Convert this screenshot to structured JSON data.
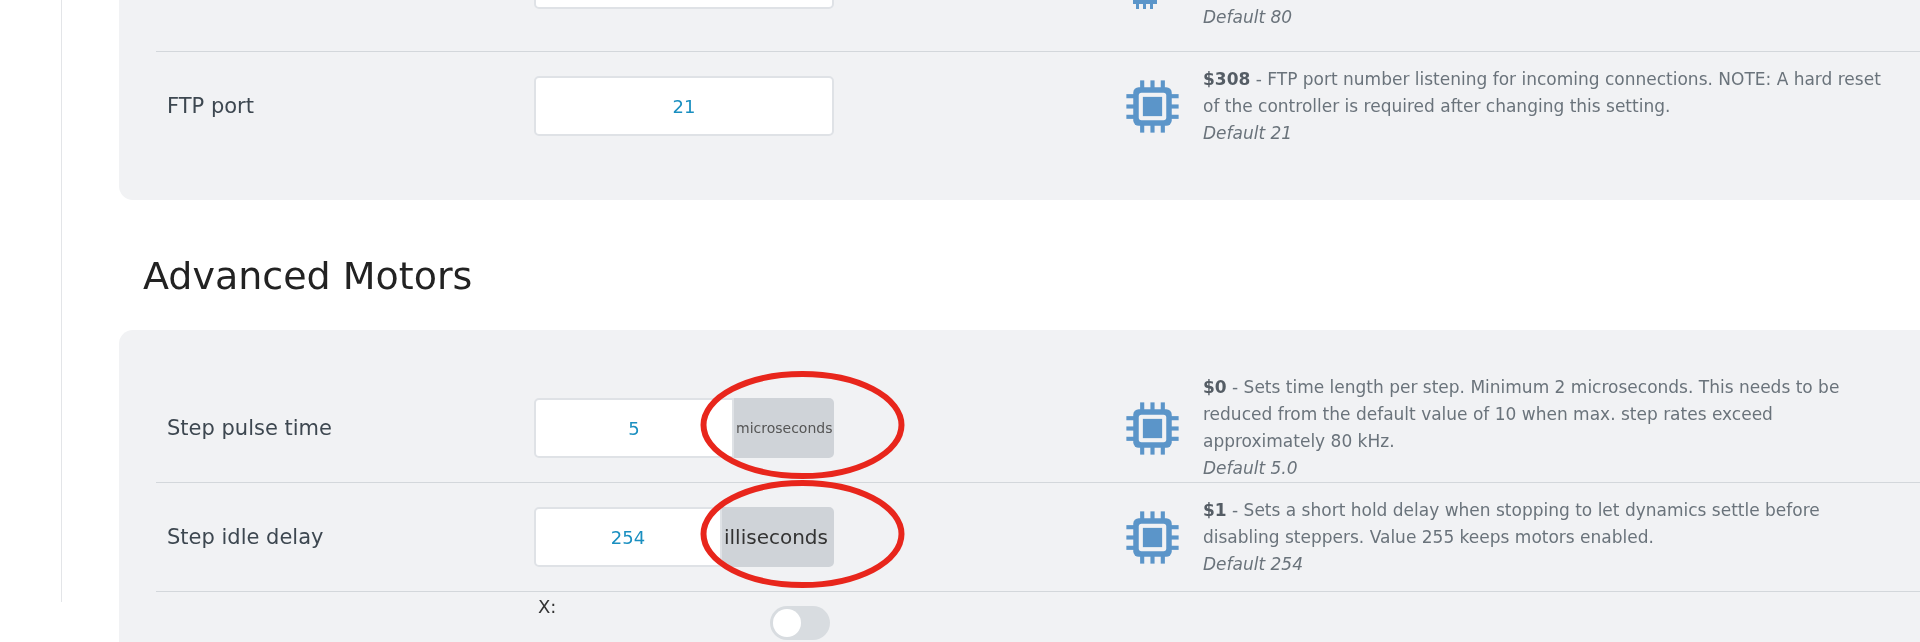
{
  "sections": [
    {
      "rows": [
        {
          "kind": "partial",
          "default": "Default 80"
        },
        {
          "kind": "setting",
          "label": "FTP port",
          "value": "21",
          "description": "**$308** - FTP port number listening for incoming connections. NOTE: A hard reset of the controller is required after changing this setting.",
          "default": "Default 21",
          "circled": false
        }
      ]
    },
    {
      "heading": "Advanced Motors",
      "rows": [
        {
          "kind": "setting",
          "label": "Step pulse time",
          "value": "5",
          "unit": {
            "kind": "compact",
            "text": "microseconds"
          },
          "description": "**$0** - Sets time length per step. Minimum 2 microseconds. This needs to be reduced from the default value of 10 when max. step rates exceed approximately 80 kHz.",
          "default": "Default 5.0",
          "circled": true
        },
        {
          "kind": "setting",
          "label": "Step idle delay",
          "value": "254",
          "unit": {
            "kind": "wide",
            "text": "illiseconds"
          },
          "description": "**$1** - Sets a short hold delay when stopping to let dynamics settle before disabling steppers. Value 255 keeps motors enabled.",
          "default": "Default 254",
          "circled": true
        },
        {
          "kind": "axis",
          "axis_label": "X:",
          "on": false
        }
      ]
    }
  ]
}
